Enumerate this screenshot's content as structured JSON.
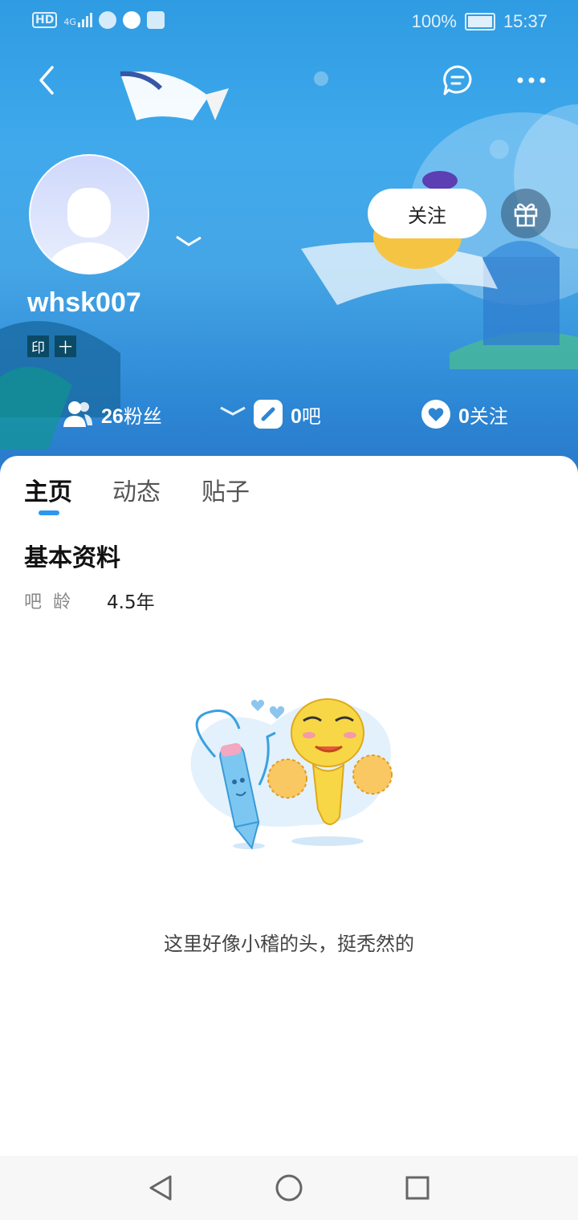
{
  "status_bar": {
    "left_icons": [
      "hd-icon",
      "signal-4g-icon",
      "wechat-icon",
      "tiktok-icon",
      "baidu-icon"
    ],
    "hd_label": "HD",
    "network_label": "4G",
    "battery_percent": "100%",
    "time": "15:37"
  },
  "top_bar": {
    "back_icon": "chevron-left-icon",
    "message_icon": "chat-bubble-icon",
    "more_icon": "more-dots-icon"
  },
  "profile": {
    "username": "whsk007",
    "badges": [
      "印",
      "十"
    ],
    "follow_label": "关注",
    "gift_icon": "gift-icon"
  },
  "stats": {
    "fans_count": "26",
    "fans_label": "粉丝",
    "bars_count": "0",
    "bars_label": "吧",
    "following_count": "0",
    "following_label": "关注"
  },
  "tabs": [
    {
      "label": "主页",
      "active": true
    },
    {
      "label": "动态",
      "active": false
    },
    {
      "label": "贴子",
      "active": false
    }
  ],
  "basic_info": {
    "title": "基本资料",
    "age_label": "吧龄",
    "age_value": "4.5年"
  },
  "empty_state": {
    "message": "这里好像小稽的头，挺秃然的"
  },
  "nav_bar": {
    "back_icon": "nav-back-triangle-icon",
    "home_icon": "nav-home-circle-icon",
    "recent_icon": "nav-recent-square-icon"
  },
  "colors": {
    "accent": "#2d97f0",
    "header_blue": "#3fa9ec",
    "badge_bg": "#0b4a66"
  }
}
